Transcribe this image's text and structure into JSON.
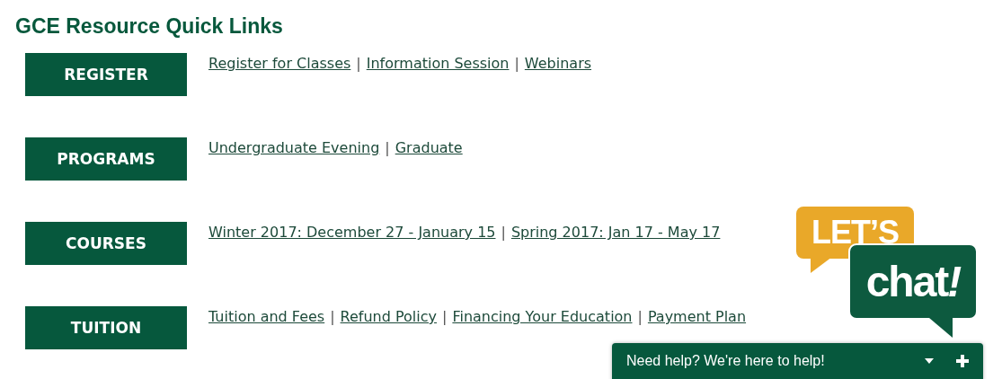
{
  "heading": "GCE Resource Quick Links",
  "rows": [
    {
      "button": "REGISTER",
      "items": [
        {
          "kind": "link",
          "text": "Register for Classes"
        },
        {
          "kind": "separator",
          "text": "|"
        },
        {
          "kind": "link",
          "text": "Information Session"
        },
        {
          "kind": "separator",
          "text": "|"
        },
        {
          "kind": "link",
          "text": "Webinars"
        }
      ]
    },
    {
      "button": "PROGRAMS",
      "items": [
        {
          "kind": "link",
          "text": "Undergraduate Evening"
        },
        {
          "kind": "separator",
          "text": "|"
        },
        {
          "kind": "link",
          "text": "Graduate"
        }
      ]
    },
    {
      "button": "COURSES",
      "items": [
        {
          "kind": "link",
          "text": "Winter 2017: December 27 - January 15"
        },
        {
          "kind": "separator",
          "text": "|"
        },
        {
          "kind": "link",
          "text": "Spring 2017: Jan 17 - May 17"
        }
      ]
    },
    {
      "button": "TUITION",
      "items": [
        {
          "kind": "link",
          "text": "Tuition and Fees"
        },
        {
          "kind": "separator",
          "text": "|"
        },
        {
          "kind": "link",
          "text": "Refund Policy"
        },
        {
          "kind": "separator",
          "text": "|"
        },
        {
          "kind": "link",
          "text": "Financing Your Education"
        },
        {
          "kind": "separator",
          "text": "|"
        },
        {
          "kind": "link",
          "text": "Payment Plan"
        }
      ]
    }
  ],
  "chat_badge": {
    "top": "LET’S",
    "bottom": "chat",
    "mark": "!"
  },
  "chat_bar": {
    "text": "Need help? We're here to help!"
  }
}
